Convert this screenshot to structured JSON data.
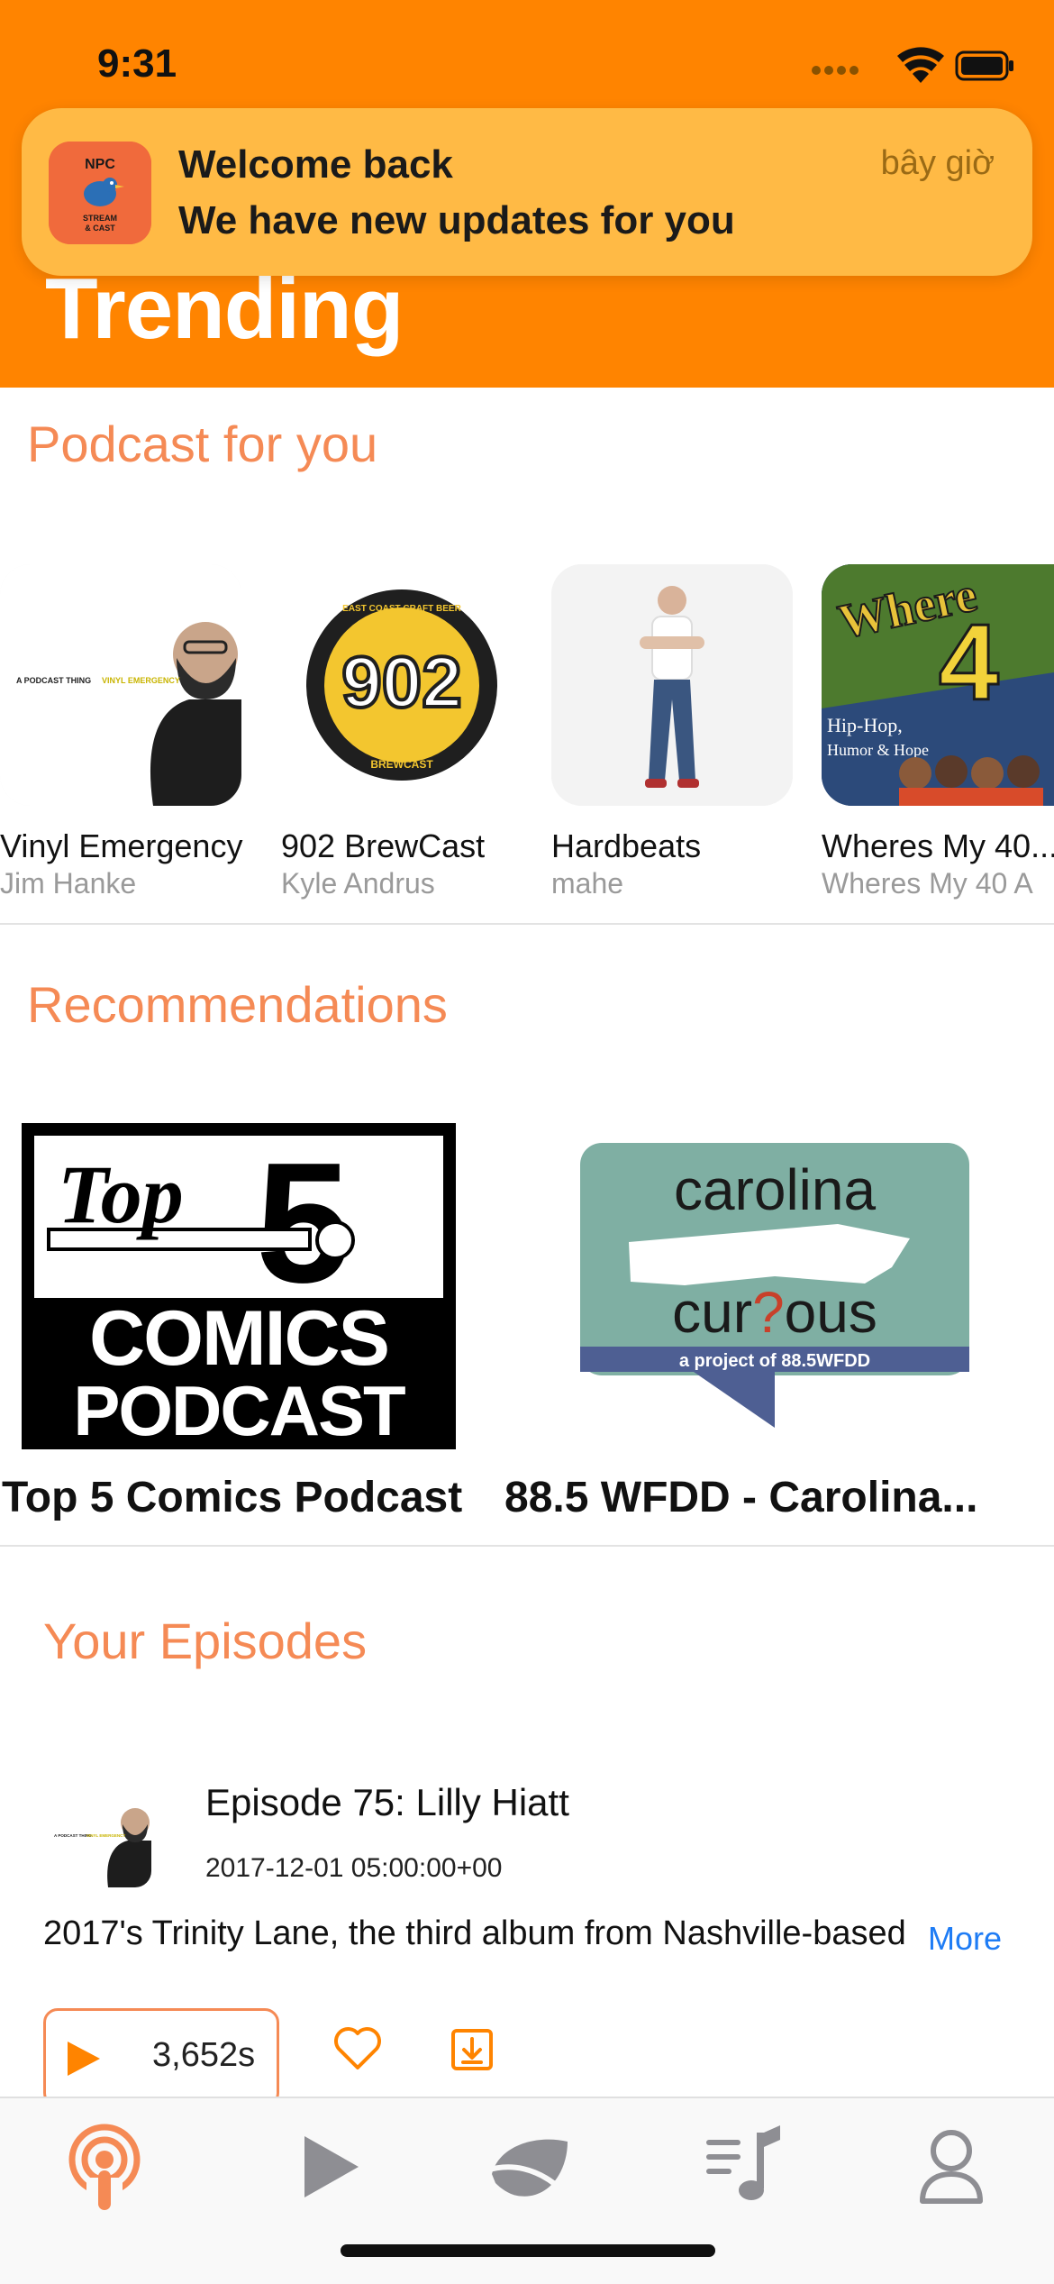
{
  "status_bar": {
    "time": "9:31"
  },
  "header": {
    "title": "Trending"
  },
  "notification": {
    "app_icon_text": "NPC STREAM & CAST",
    "title": "Welcome back",
    "body": "We have new updates for you",
    "time": "bây giờ"
  },
  "podcasts_section": {
    "title": "Podcast for you",
    "items": [
      {
        "title": "Vinyl Emergency",
        "author": "Jim Hanke",
        "art_text": "A PODCAST THING VINYL EMERGENCY"
      },
      {
        "title": "902 BrewCast",
        "author": "Kyle Andrus",
        "art_text": "902",
        "art_ring_top": "EAST COAST CRAFT BEER",
        "art_ring_bottom": "BREWCAST"
      },
      {
        "title": "Hardbeats",
        "author": "mahe"
      },
      {
        "title": "Wheres My 40...",
        "author": "Wheres My 40 A",
        "art_text": "Hip-Hop, Humor & Hope"
      }
    ]
  },
  "recommendations": {
    "title": "Recommendations",
    "items": [
      {
        "title": "Top 5 Comics Podcast",
        "art_line1": "Top 5",
        "art_line2": "COMICS",
        "art_line3": "PODCAST"
      },
      {
        "title": "88.5 WFDD - Carolina...",
        "art_line1": "carolina",
        "art_line2": "cur?ous",
        "art_line3": "a project of 88.5WFDD"
      }
    ]
  },
  "episodes": {
    "title": "Your Episodes",
    "item": {
      "title": "Episode 75: Lilly Hiatt",
      "date": "2017-12-01 05:00:00+00",
      "description": "2017's Trinity Lane, the third album from Nashville-based",
      "more_label": "More",
      "duration": "3,652s"
    }
  },
  "tabbar": {
    "tabs": [
      {
        "icon": "podcast-icon",
        "active": true
      },
      {
        "icon": "play-icon",
        "active": false
      },
      {
        "icon": "leaf-icon",
        "active": false
      },
      {
        "icon": "playlist-icon",
        "active": false
      },
      {
        "icon": "profile-icon",
        "active": false
      }
    ]
  },
  "colors": {
    "header": "#FF8400",
    "accent": "#F58A55",
    "notification": "#FFBA45",
    "link": "#1E7CF5"
  }
}
